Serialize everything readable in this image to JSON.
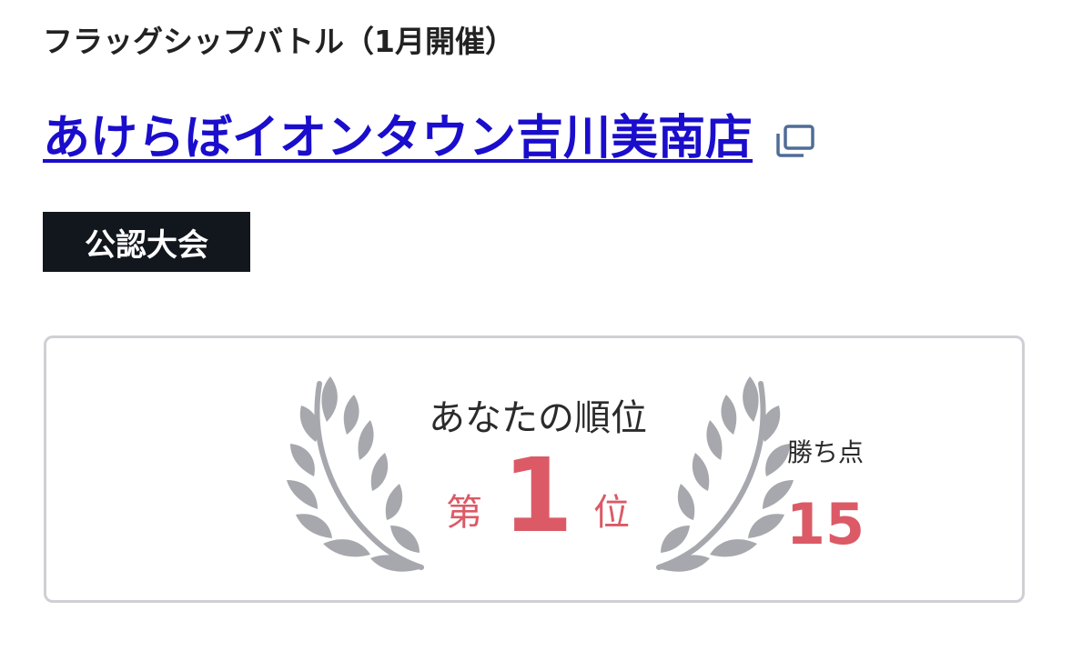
{
  "event": {
    "name": "フラッグシップバトル（1月開催）"
  },
  "store": {
    "name": "あけらぼイオンタウン吉川美南店",
    "link_icon": "external-link-icon"
  },
  "badge": {
    "label": "公認大会"
  },
  "result": {
    "rank_label": "あなたの順位",
    "rank_prefix": "第",
    "rank_number": "1",
    "rank_suffix": "位",
    "points_label": "勝ち点",
    "points_value": "15",
    "laurel_icon": "laurel-wreath-icon",
    "accent_color": "#db5a66"
  }
}
